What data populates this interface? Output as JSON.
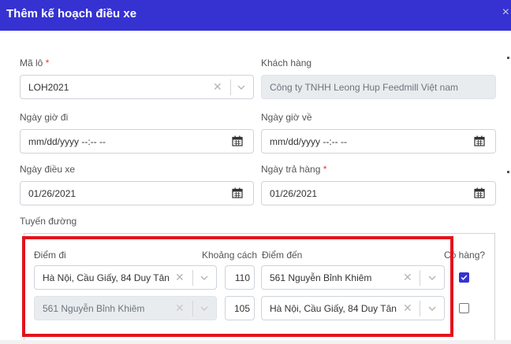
{
  "header": {
    "title": "Thêm kế hoạch điều xe",
    "close": "×"
  },
  "form": {
    "lot_label": "Mã lô",
    "required_mark": "*",
    "lot_value": "LOH2021",
    "customer_label": "Khách hàng",
    "customer_value": "Công ty TNHH Leong Hup Feedmill Việt nam",
    "depart_label": "Ngày giờ đi",
    "depart_value": "mm/dd/yyyy --:-- --",
    "return_label": "Ngày giờ về",
    "return_value": "mm/dd/yyyy --:-- --",
    "dispatch_label": "Ngày điều xe",
    "dispatch_value": "01/26/2021",
    "delivery_label": "Ngày trả hàng",
    "delivery_value": "01/26/2021",
    "route_label": "Tuyến đường"
  },
  "route": {
    "col_from": "Điểm đi",
    "col_distance": "Khoảng cách",
    "col_to": "Điểm đến",
    "col_cargo": "Có hàng?",
    "rows": [
      {
        "from": "Hà Nội, Cầu Giấy, 84 Duy Tân",
        "distance": "110",
        "to": "561 Nguyễn Bỉnh Khiêm",
        "cargo": true
      },
      {
        "from": "561 Nguyễn Bỉnh Khiêm",
        "distance": "105",
        "to": "Hà Nội, Cầu Giấy, 84 Duy Tân",
        "cargo": false
      }
    ]
  },
  "icons": [
    "close-icon",
    "clear-icon",
    "chevron-down-icon",
    "calendar-icon"
  ],
  "colors": {
    "header": "#3532d1",
    "highlight": "#e3131c",
    "required": "#e53935"
  }
}
